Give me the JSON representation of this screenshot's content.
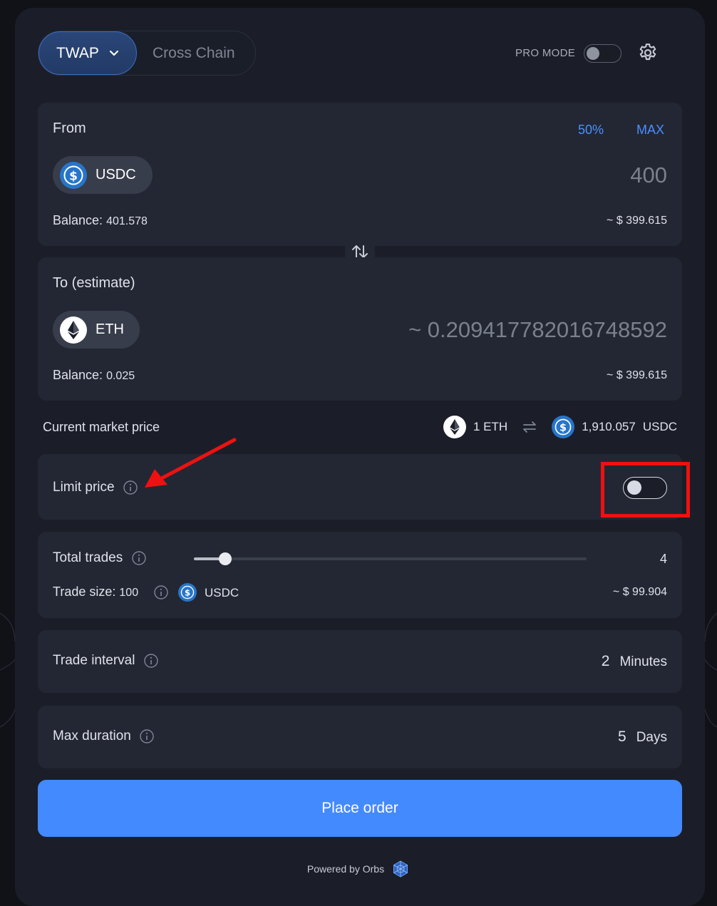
{
  "modes": {
    "twap": "TWAP",
    "cross_chain": "Cross Chain"
  },
  "pro_mode": {
    "label": "PRO MODE",
    "enabled": false
  },
  "from": {
    "label": "From",
    "pct_50": "50%",
    "max": "MAX",
    "token": "USDC",
    "amount": "400",
    "balance_label": "Balance:",
    "balance_value": "401.578",
    "usd_value": "~ $ 399.615"
  },
  "to": {
    "label": "To (estimate)",
    "token": "ETH",
    "amount": "~ 0.209417782016748592",
    "balance_label": "Balance:",
    "balance_value": "0.025",
    "usd_value": "~ $ 399.615"
  },
  "market": {
    "label": "Current market price",
    "left": "1 ETH",
    "right_value": "1,910.057",
    "right_token": "USDC"
  },
  "limit": {
    "label": "Limit price",
    "enabled": false
  },
  "trades": {
    "label": "Total trades",
    "value": "4",
    "slider_fraction": 0.08,
    "trade_size_label": "Trade size:",
    "trade_size_value": "100",
    "trade_size_token": "USDC",
    "trade_size_usd": "~ $ 99.904"
  },
  "interval": {
    "label": "Trade interval",
    "value": "2",
    "unit": "Minutes"
  },
  "duration": {
    "label": "Max duration",
    "value": "5",
    "unit": "Days"
  },
  "place_order": "Place order",
  "powered_by": "Powered by Orbs",
  "colors": {
    "accent": "#448aff",
    "highlight": "#ee1111",
    "panel": "#232734"
  }
}
